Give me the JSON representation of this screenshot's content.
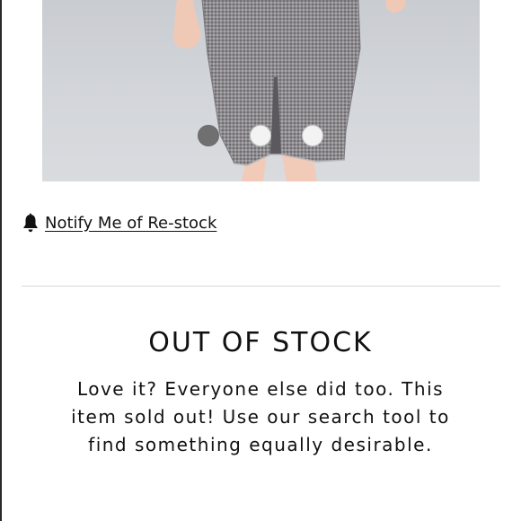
{
  "product_gallery": {
    "image_alt": "Gray houndstooth pencil skirt with front slit",
    "dots": [
      {
        "state": "active"
      },
      {
        "state": "inactive"
      },
      {
        "state": "inactive"
      }
    ]
  },
  "restock": {
    "icon": "bell-icon",
    "link_text": "Notify Me of Re-stock"
  },
  "stock_notice": {
    "title": "OUT OF STOCK",
    "message": "Love it? Everyone else did too. This item sold out! Use our search tool to find something equally desirable."
  },
  "colors": {
    "text": "#111111",
    "divider": "#d8d8d8",
    "dot_active": "#707070",
    "dot_inactive": "#f3f3f3"
  }
}
